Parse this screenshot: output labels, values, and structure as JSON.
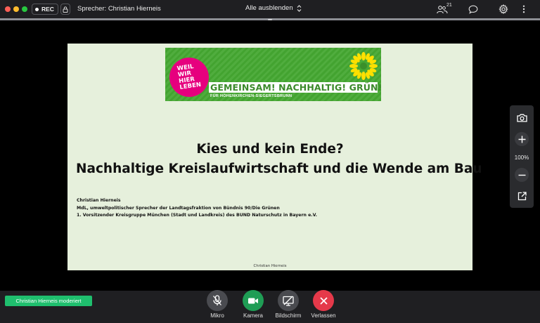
{
  "topbar": {
    "rec_label": "REC",
    "speaker_label": "Sprecher: Christian Hierneis",
    "hide_all_label": "Alle ausblenden",
    "participants_count": "21",
    "icons": [
      "lock-icon",
      "updown-chevron-icon",
      "participants-icon",
      "chat-icon",
      "gear-icon",
      "more-vertical-icon"
    ]
  },
  "slide": {
    "banner": {
      "badge_lines": [
        "WEIL",
        "WIR",
        "HIER",
        "LEBEN"
      ],
      "title": "GEMEINSAM! NACHHALTIG! GRÜN!",
      "subtitle": "FÜR HÖHENKIRCHEN-SIEGERTSBRUNN",
      "colors": {
        "green": "#45a832",
        "magenta": "#e6007e",
        "yellow": "#ffe000"
      }
    },
    "title_line1": "Kies und kein Ende?",
    "title_line2": "Nachhaltige Kreislaufwirtschaft und die Wende am Bau",
    "author_name": "Christian Hierneis",
    "author_role1": "MdL, umweltpolitischer Sprecher der Landtagsfraktion von Bündnis 90/Die Grünen",
    "author_role2": "1. Vorsitzender Kreisgruppe München (Stadt und Landkreis) des BUND Naturschutz in Bayern e.V.",
    "footer": "Christian Hierneis"
  },
  "zoom_panel": {
    "zoom_level": "100%",
    "icons": [
      "camera-icon",
      "plus-icon",
      "minus-icon",
      "external-open-icon"
    ]
  },
  "bottombar": {
    "moderated_text": "Christian Hierneis moderiert",
    "controls": [
      {
        "label": "Mikro",
        "icon": "mic-off-icon",
        "color": "#4a4b50"
      },
      {
        "label": "Kamera",
        "icon": "video-icon",
        "color": "#1f9d55"
      },
      {
        "label": "Bildschirm",
        "icon": "screen-share-off-icon",
        "color": "#4a4b50"
      },
      {
        "label": "Verlassen",
        "icon": "close-icon",
        "color": "#e5394a"
      }
    ]
  }
}
